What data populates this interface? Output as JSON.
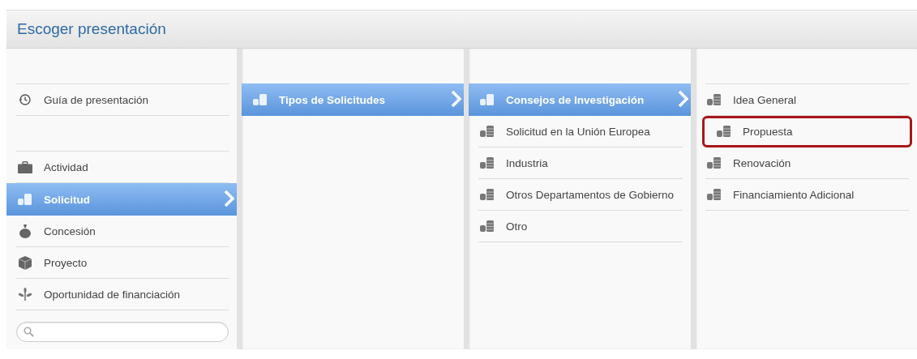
{
  "title": "Escoger presentación",
  "columns": [
    {
      "groups": [
        {
          "items": [
            {
              "kind": "history",
              "label": "Guía de presentación",
              "selected": false
            }
          ]
        },
        {
          "items": [
            {
              "kind": "briefcase",
              "label": "Actividad",
              "selected": false
            },
            {
              "kind": "coins",
              "label": "Solicitud",
              "selected": true
            },
            {
              "kind": "moneybag",
              "label": "Concesión",
              "selected": false
            },
            {
              "kind": "box",
              "label": "Proyecto",
              "selected": false
            },
            {
              "kind": "sprout",
              "label": "Oportunidad de financiación",
              "selected": false
            }
          ]
        }
      ],
      "search": {
        "kind": "search"
      }
    },
    {
      "groups": [
        {
          "items": [
            {
              "kind": "coins",
              "label": "Tipos de Solicitudes",
              "selected": true
            }
          ]
        }
      ]
    },
    {
      "groups": [
        {
          "items": [
            {
              "kind": "coins",
              "label": "Consejos de Investigación",
              "selected": true
            },
            {
              "kind": "coins",
              "label": "Solicitud en la Unión Europea",
              "selected": false
            },
            {
              "kind": "coins",
              "label": "Industria",
              "selected": false
            },
            {
              "kind": "coins",
              "label": "Otros Departamentos de Gobierno",
              "selected": false
            },
            {
              "kind": "coins",
              "label": "Otro",
              "selected": false
            }
          ]
        }
      ]
    },
    {
      "groups": [
        {
          "items": [
            {
              "kind": "coins",
              "label": "Idea General",
              "selected": false,
              "outlined": false
            },
            {
              "kind": "coins",
              "label": "Propuesta",
              "selected": false,
              "outlined": true
            },
            {
              "kind": "coins",
              "label": "Renovación",
              "selected": false,
              "outlined": false
            },
            {
              "kind": "coins",
              "label": "Financiamiento Adicional",
              "selected": false,
              "outlined": false
            }
          ]
        }
      ]
    }
  ]
}
